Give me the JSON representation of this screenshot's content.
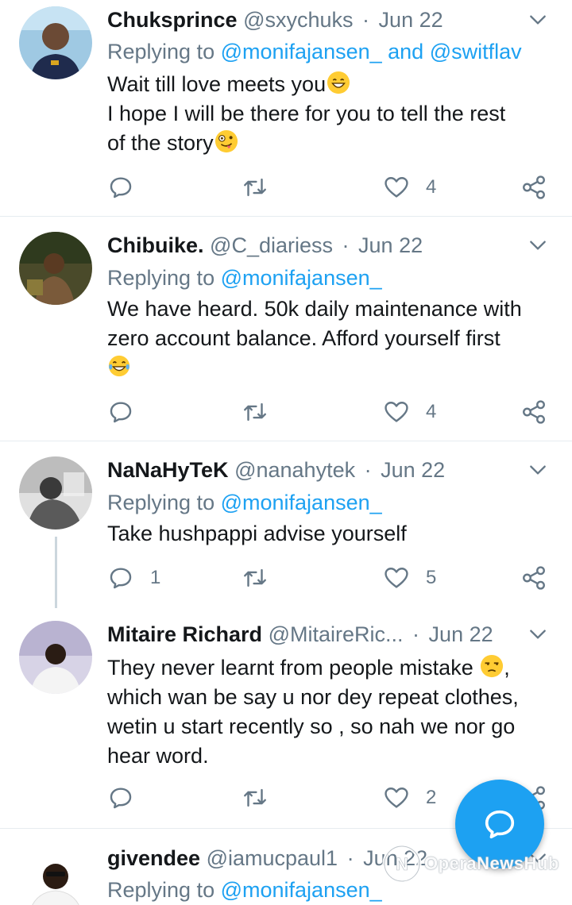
{
  "tweets": [
    {
      "name": "Chuksprince",
      "handle": "@sxychuks",
      "separator": "·",
      "date": "Jun 22",
      "replying_prefix": "Replying to",
      "mentions": "@monifajansen_ and @switflav",
      "text_lines": [
        "Wait till love meets you",
        "I hope I will be there for you to tell the rest",
        "of the story"
      ],
      "emojis": [
        "grinning-face-with-smiling-eyes",
        "zany-face"
      ],
      "reply_count": "",
      "like_count": "4"
    },
    {
      "name": "Chibuike.",
      "handle": "@C_diariess",
      "separator": "·",
      "date": "Jun 22",
      "replying_prefix": "Replying to",
      "mentions": "@monifajansen_",
      "text_lines": [
        "We have heard. 50k daily maintenance with",
        "zero account balance. Afford yourself first"
      ],
      "emojis": [
        "face-with-tears-of-joy"
      ],
      "reply_count": "",
      "like_count": "4"
    },
    {
      "name": "NaNaHyTeK",
      "handle": "@nanahytek",
      "separator": "·",
      "date": "Jun 22",
      "replying_prefix": "Replying to",
      "mentions": "@monifajansen_",
      "text_lines": [
        "Take hushpappi advise yourself"
      ],
      "emojis": [],
      "reply_count": "1",
      "like_count": "5"
    },
    {
      "name": "Mitaire Richard",
      "handle": "@MitaireRic...",
      "separator": "·",
      "date": "Jun 22",
      "replying_prefix": "",
      "mentions": "",
      "text_lines": [
        "They never learnt from people mistake",
        ",",
        "which wan be say u nor dey repeat clothes,",
        "wetin u start recently so , so nah we nor go",
        "hear word."
      ],
      "emojis": [
        "unamused-face"
      ],
      "reply_count": "",
      "like_count": "2"
    },
    {
      "name": "givendee",
      "handle": "@iamucpaul1",
      "separator": "·",
      "date": "Jun 22",
      "replying_prefix": "Replying to",
      "mentions": "@monifajansen_",
      "text_lines": [],
      "emojis": [],
      "reply_count": "",
      "like_count": ""
    }
  ],
  "icons": {
    "reply": "reply-icon",
    "retweet": "retweet-icon",
    "like": "heart-icon",
    "share": "share-icon",
    "menu": "chevron-down-icon",
    "compose": "compose-reply-icon"
  },
  "colors": {
    "accent": "#1da1f2",
    "secondary_text": "#657786",
    "divider": "#e6ecf0"
  },
  "watermark": "OperaNewsHub"
}
